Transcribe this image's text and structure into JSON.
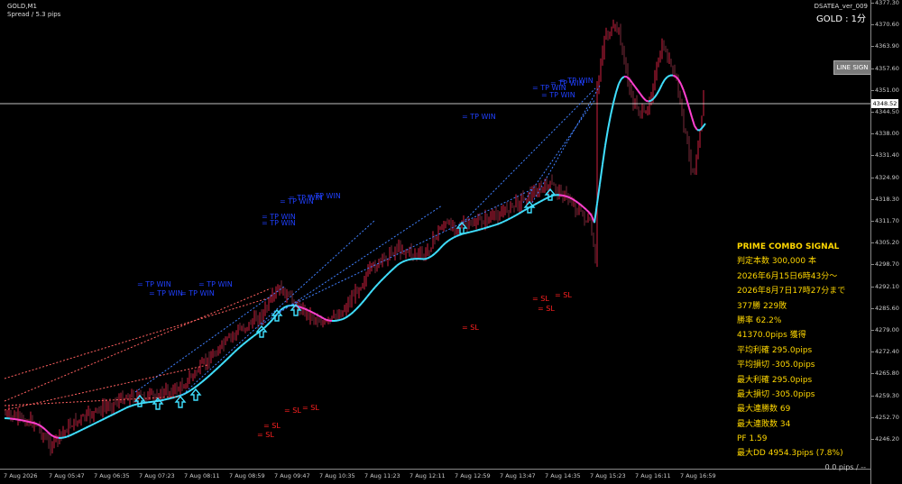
{
  "header": {
    "symbol": "GOLD,M1",
    "spread": "Spread / 5.3 pips",
    "brand": "DSATEA_ver_009",
    "timeframe": "GOLD : 1分"
  },
  "button": {
    "line_sign": "LINE SIGN"
  },
  "current_price": "4348.52",
  "y_axis": [
    "4377.30",
    "4370.60",
    "4363.90",
    "4357.60",
    "4351.00",
    "4344.50",
    "4338.00",
    "4331.40",
    "4324.90",
    "4318.30",
    "4311.70",
    "4305.20",
    "4298.70",
    "4292.10",
    "4285.60",
    "4279.00",
    "4272.40",
    "4265.80",
    "4259.30",
    "4252.70",
    "4246.20"
  ],
  "x_axis": [
    "7 Aug 2026",
    "7 Aug 05:47",
    "7 Aug 06:35",
    "7 Aug 07:23",
    "7 Aug 08:11",
    "7 Aug 08:59",
    "7 Aug 09:47",
    "7 Aug 10:35",
    "7 Aug 11:23",
    "7 Aug 12:11",
    "7 Aug 12:59",
    "7 Aug 13:47",
    "7 Aug 14:35",
    "7 Aug 15:23",
    "7 Aug 16:11",
    "7 Aug 16:59"
  ],
  "pips_label": "0.0 pips / --",
  "labels": {
    "tp": "TP WIN",
    "sl": "SL"
  },
  "panel": {
    "title": "PRIME COMBO SIGNAL",
    "lines": [
      "判定本数 300,000 本",
      "2026年6月15日6時43分～",
      "2026年8月7日17時27分まで",
      "377勝 229敗",
      "勝率 62.2%",
      "41370.0pips 獲得",
      "平均利確 295.0pips",
      "平均損切 -305.0pips",
      "最大利確 295.0pips",
      "最大損切 -305.0pips",
      "最大連勝数 69",
      "最大連敗数 34",
      "PF 1.59",
      "最大DD 4954.3pips (7.8%)"
    ]
  },
  "colors": {
    "bull": "#d02040",
    "bear": "#7a2a3a",
    "ma_up": "#40e0ff",
    "ma_down": "#ff40d0",
    "tp": "#2040ff",
    "sl": "#ff2020",
    "panel_text": "#ffd700"
  }
}
